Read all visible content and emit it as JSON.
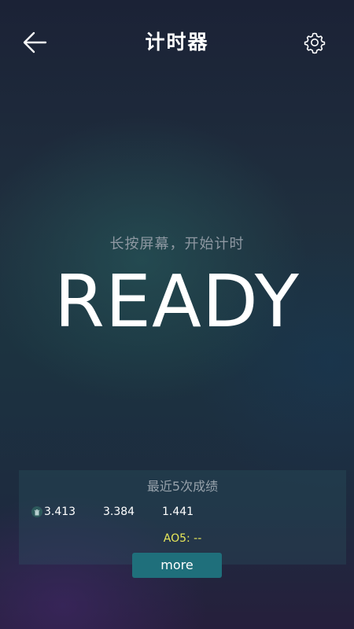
{
  "header": {
    "title": "计时器",
    "back_icon": "arrow-left-icon",
    "settings_icon": "gear-icon"
  },
  "timer": {
    "hint": "长按屏幕，开始计时",
    "status": "READY"
  },
  "recent": {
    "title": "最近5次成绩",
    "results": [
      "3.413",
      "3.384",
      "1.441"
    ],
    "ao5": "AO5: --",
    "more_label": "more"
  },
  "colors": {
    "ao5_text": "#e8e85a",
    "more_button": "#1f6f7b"
  }
}
